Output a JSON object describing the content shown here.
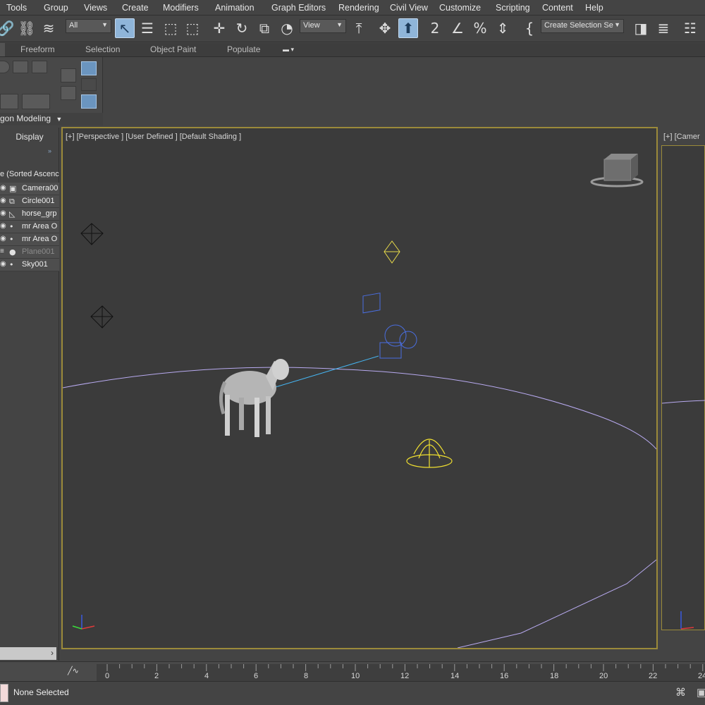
{
  "menu": [
    "Tools",
    "Group",
    "Views",
    "Create",
    "Modifiers",
    "Animation",
    "Graph Editors",
    "Rendering",
    "Civil View",
    "Customize",
    "Scripting",
    "Content",
    "Help"
  ],
  "toolbar": {
    "filter_value": "All",
    "reference_coord_value": "View",
    "selection_set_value": "Create Selection Se"
  },
  "ribbon": {
    "tabs": [
      "Freeform",
      "Selection",
      "Object Paint",
      "Populate"
    ],
    "panel_label": "gon Modeling"
  },
  "explorer": {
    "tab": "Display",
    "sort_label": "e (Sorted Ascenc",
    "items": [
      {
        "name": "Camera00",
        "icon": "camera-icon"
      },
      {
        "name": "Circle001",
        "icon": "shape-icon"
      },
      {
        "name": "horse_grp",
        "icon": "group-icon"
      },
      {
        "name": "mr Area O",
        "icon": "light-icon"
      },
      {
        "name": "mr Area O",
        "icon": "light-icon"
      },
      {
        "name": "Plane001",
        "icon": "geometry-icon"
      },
      {
        "name": "Sky001",
        "icon": "light-icon"
      }
    ]
  },
  "viewport_main": {
    "label": "[+] [Perspective ] [User Defined ] [Default Shading ]"
  },
  "viewport_right": {
    "label": "[+] [Camer"
  },
  "timeline": {
    "ticks": [
      "0",
      "2",
      "4",
      "6",
      "8",
      "10",
      "12",
      "14",
      "16",
      "18",
      "20",
      "22",
      "24"
    ]
  },
  "status": {
    "text": "None Selected"
  }
}
